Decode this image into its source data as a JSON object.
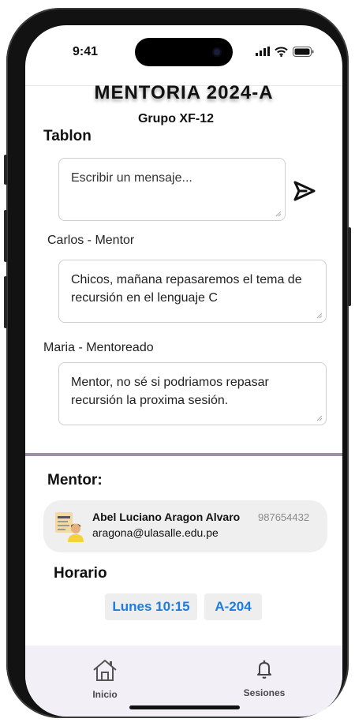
{
  "status_bar": {
    "time": "9:41"
  },
  "header": {
    "title": "MENTORIA 2024-A",
    "subtitle": "Grupo XF-12"
  },
  "board": {
    "title": "Tablon",
    "input_placeholder": "Escribir un mensaje...",
    "messages": [
      {
        "author": "Carlos - Mentor",
        "text": "Chicos, mañana repasaremos el tema de recursión en el lenguaje C"
      },
      {
        "author": "Maria - Mentoreado",
        "text": "Mentor, no sé si podriamos repasar recursión la proxima sesión."
      }
    ]
  },
  "mentor": {
    "section_title": "Mentor:",
    "name": "Abel Luciano Aragon Alvaro",
    "phone": "987654432",
    "email": "aragona@ulasalle.edu.pe"
  },
  "schedule": {
    "title": "Horario",
    "day_time": "Lunes 10:15",
    "room": "A-204"
  },
  "nav": {
    "items": [
      {
        "label": "Inicio",
        "icon": "home-icon"
      },
      {
        "label": "Sesiones",
        "icon": "bell-icon"
      }
    ]
  },
  "colors": {
    "accent": "#1e7be0",
    "divider": "#9b92a6",
    "nav_bg": "#f2eff7"
  }
}
